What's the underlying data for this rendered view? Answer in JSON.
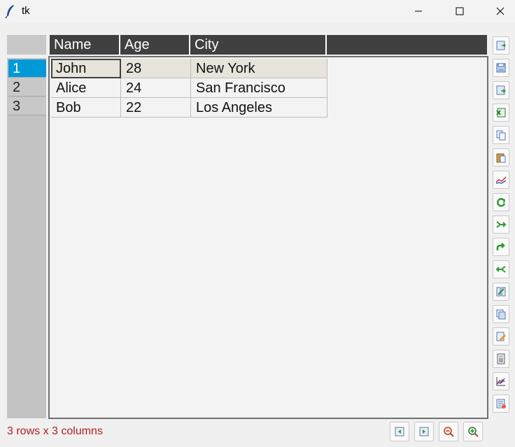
{
  "window": {
    "title": "tk",
    "controls": [
      "minimize",
      "maximize",
      "close"
    ]
  },
  "table": {
    "columns": [
      "Name",
      "Age",
      "City"
    ],
    "row_indices": [
      "1",
      "2",
      "3"
    ],
    "rows": [
      [
        "John",
        "28",
        "New York"
      ],
      [
        "Alice",
        "24",
        "San Francisco"
      ],
      [
        "Bob",
        "22",
        "Los Angeles"
      ]
    ],
    "selected_row": 1,
    "active_cell": {
      "row": 1,
      "column": "Name"
    }
  },
  "toolbar": {
    "icons": [
      "save-icon",
      "save-as-icon",
      "import-icon",
      "excel-icon",
      "copy-icon",
      "paste-icon",
      "plot-icon",
      "transform-icon",
      "merge-icon",
      "pivot-icon",
      "melt-icon",
      "aggregate-icon",
      "duplicate-icon",
      "edit-icon",
      "calculator-icon",
      "chart-icon",
      "table-info-icon"
    ]
  },
  "bottom_bar": {
    "status_text": "3 rows x 3 columns",
    "icons": [
      "prev-page-icon",
      "next-page-icon",
      "zoom-out-icon",
      "zoom-in-icon"
    ]
  },
  "colors": {
    "header_bg": "#404040",
    "selected_index_bg": "#0099d8",
    "selected_row_bg": "#e8e4dc",
    "status_text": "#b22020"
  }
}
